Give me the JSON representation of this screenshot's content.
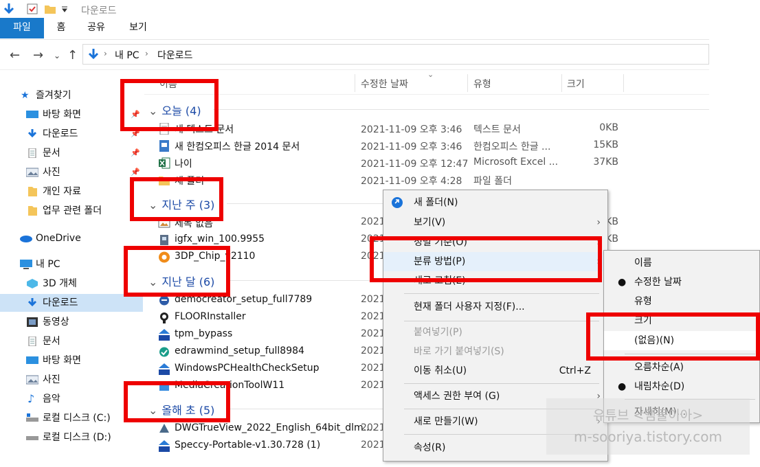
{
  "window": {
    "title": "다운로드"
  },
  "ribbon": {
    "tabs": [
      "파일",
      "홈",
      "공유",
      "보기"
    ]
  },
  "address": {
    "path": [
      "내 PC",
      "다운로드"
    ]
  },
  "sidebar": {
    "quick_access": "즐겨찾기",
    "items": [
      "바탕 화면",
      "다운로드",
      "문서",
      "사진",
      "개인 자료",
      "업무 관련 폴더"
    ],
    "onedrive": "OneDrive",
    "this_pc": "내 PC",
    "pc_items": [
      "3D 개체",
      "다운로드",
      "동영상",
      "문서",
      "바탕 화면",
      "사진",
      "음악",
      "로컬 디스크 (C:)",
      "로컬 디스크 (D:)"
    ]
  },
  "columns": {
    "name": "이름",
    "date": "수정한 날짜",
    "type": "유형",
    "size": "크기"
  },
  "groups": [
    {
      "label": "오늘 (4)"
    },
    {
      "label": "지난 주 (3)"
    },
    {
      "label": "지난 달 (6)"
    },
    {
      "label": "올해 초 (5)"
    }
  ],
  "files": [
    {
      "name": "새 텍스트 문서",
      "date": "2021-11-09 오후 3:46",
      "type": "텍스트 문서",
      "size": "0KB"
    },
    {
      "name": "새 한컴오피스 한글 2014 문서",
      "date": "2021-11-09 오후 3:46",
      "type": "한컴오피스 한글 ...",
      "size": "15KB"
    },
    {
      "name": "나이",
      "date": "2021-11-09 오후 12:47",
      "type": "Microsoft Excel ...",
      "size": "37KB"
    },
    {
      "name": "새 폴더",
      "date": "2021-11-09 오후 4:28",
      "type": "파일 폴더",
      "size": ""
    },
    {
      "name": "제목 없음",
      "date": "2021",
      "type": "",
      "size": "KB"
    },
    {
      "name": "igfx_win_100.9955",
      "date": "2021",
      "type": "",
      "size": "KB"
    },
    {
      "name": "3DP_Chip_v2110",
      "date": "2021",
      "type": "",
      "size": ""
    },
    {
      "name": "democreator_setup_full7789",
      "date": "2021",
      "type": "",
      "size": ""
    },
    {
      "name": "FLOORInstaller",
      "date": "2021",
      "type": "",
      "size": ""
    },
    {
      "name": "tpm_bypass",
      "date": "2021",
      "type": "",
      "size": ""
    },
    {
      "name": "edrawmind_setup_full8984",
      "date": "2021",
      "type": "",
      "size": ""
    },
    {
      "name": "WindowsPCHealthCheckSetup",
      "date": "2021",
      "type": "",
      "size": ""
    },
    {
      "name": "MediaCreationToolW11",
      "date": "2021",
      "type": "",
      "size": ""
    },
    {
      "name": "DWGTrueView_2022_English_64bit_dlm....",
      "date": "2021",
      "type": "",
      "size": ""
    },
    {
      "name": "Speccy-Portable-v1.30.728 (1)",
      "date": "2021",
      "type": "",
      "size": ""
    }
  ],
  "context_menu": {
    "items": [
      {
        "label": "새 폴더(N)"
      },
      {
        "label": "보기(V)"
      },
      {
        "label": "정렬 기준(O)"
      },
      {
        "label": "분류 방법(P)"
      },
      {
        "label": "새로 고침(E)"
      },
      {
        "label": "현재 폴더 사용자 지정(F)..."
      },
      {
        "label": "붙여넣기(P)"
      },
      {
        "label": "바로 가기 붙여넣기(S)"
      },
      {
        "label": "이동 취소(U)",
        "shortcut": "Ctrl+Z"
      },
      {
        "label": "액세스 권한 부여 (G)"
      },
      {
        "label": "새로 만들기(W)"
      },
      {
        "label": "속성(R)"
      }
    ]
  },
  "submenu": {
    "items": [
      {
        "label": "이름"
      },
      {
        "label": "수정한 날짜"
      },
      {
        "label": "유형"
      },
      {
        "label": "크기"
      },
      {
        "label": "(없음)(N)"
      },
      {
        "label": "오름차순(A)"
      },
      {
        "label": "내림차순(D)"
      },
      {
        "label": "자세히(M)..."
      }
    ]
  },
  "watermark": {
    "line1": "유튜브 <엠돌이아>",
    "line2": "m-sooriya.tistory.com"
  },
  "colors": {
    "accent": "#1979ca",
    "highlight": "#ee0000",
    "group_text": "#1c4aa6"
  }
}
